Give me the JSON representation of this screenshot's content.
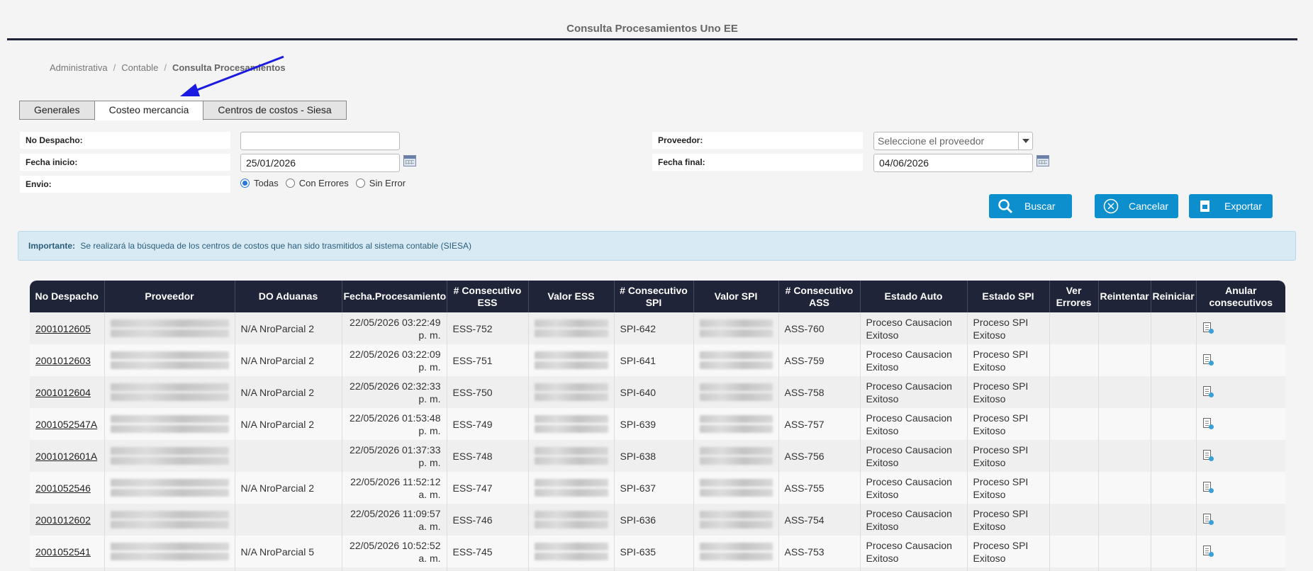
{
  "page": {
    "title": "Consulta Procesamientos Uno EE"
  },
  "breadcrumb": [
    "Administrativa",
    "Contable",
    "Consulta Procesamientos"
  ],
  "tabs": [
    "Generales",
    "Costeo mercancia",
    "Centros de costos - Siesa"
  ],
  "active_tab": "Costeo mercancia",
  "form": {
    "no_despacho_label": "No Despacho:",
    "no_despacho_value": "",
    "fecha_inicio_label": "Fecha inicio:",
    "fecha_inicio_value": "25/01/2026",
    "envio_label": "Envio:",
    "envio_options": [
      "Todas",
      "Con Errores",
      "Sin Error"
    ],
    "envio_selected": "Todas",
    "proveedor_label": "Proveedor:",
    "proveedor_placeholder": "Seleccione el proveedor",
    "fecha_final_label": "Fecha final:",
    "fecha_final_value": "04/06/2026"
  },
  "buttons": {
    "buscar": "Buscar",
    "cancelar": "Cancelar",
    "exportar": "Exportar"
  },
  "notice": {
    "strong": "Importante:",
    "text": "Se realizará la búsqueda de los centros de costos que han sido trasmitidos al sistema contable (SIESA)"
  },
  "table": {
    "headers": [
      "No Despacho",
      "Proveedor",
      "DO Aduanas",
      "Fecha.Procesamiento",
      "# Consecutivo ESS",
      "Valor ESS",
      "# Consecutivo SPI",
      "Valor SPI",
      "# Consecutivo ASS",
      "Estado Auto",
      "Estado SPI",
      "Ver Errores",
      "Reintentar",
      "Reiniciar",
      "Anular consecutivos"
    ],
    "rows": [
      {
        "no_despacho": "2001012605",
        "do_aduanas": "N/A NroParcial 2",
        "fecha": "22/05/2026 03:22:49 p. m.",
        "ess": "ESS-752",
        "spi": "SPI-642",
        "ass": "ASS-760",
        "estado_auto": "Proceso Causacion Exitoso",
        "estado_spi": "Proceso SPI Exitoso"
      },
      {
        "no_despacho": "2001012603",
        "do_aduanas": "N/A NroParcial 2",
        "fecha": "22/05/2026 03:22:09 p. m.",
        "ess": "ESS-751",
        "spi": "SPI-641",
        "ass": "ASS-759",
        "estado_auto": "Proceso Causacion Exitoso",
        "estado_spi": "Proceso SPI Exitoso"
      },
      {
        "no_despacho": "2001012604",
        "do_aduanas": "N/A NroParcial 2",
        "fecha": "22/05/2026 02:32:33 p. m.",
        "ess": "ESS-750",
        "spi": "SPI-640",
        "ass": "ASS-758",
        "estado_auto": "Proceso Causacion Exitoso",
        "estado_spi": "Proceso SPI Exitoso"
      },
      {
        "no_despacho": "2001052547A",
        "do_aduanas": "N/A NroParcial 2",
        "fecha": "22/05/2026 01:53:48 p. m.",
        "ess": "ESS-749",
        "spi": "SPI-639",
        "ass": "ASS-757",
        "estado_auto": "Proceso Causacion Exitoso",
        "estado_spi": "Proceso SPI Exitoso"
      },
      {
        "no_despacho": "2001012601A",
        "do_aduanas": "",
        "fecha": "22/05/2026 01:37:33 p. m.",
        "ess": "ESS-748",
        "spi": "SPI-638",
        "ass": "ASS-756",
        "estado_auto": "Proceso Causacion Exitoso",
        "estado_spi": "Proceso SPI Exitoso"
      },
      {
        "no_despacho": "2001052546",
        "do_aduanas": "N/A NroParcial 2",
        "fecha": "22/05/2026 11:52:12 a. m.",
        "ess": "ESS-747",
        "spi": "SPI-637",
        "ass": "ASS-755",
        "estado_auto": "Proceso Causacion Exitoso",
        "estado_spi": "Proceso SPI Exitoso"
      },
      {
        "no_despacho": "2001012602",
        "do_aduanas": "",
        "fecha": "22/05/2026 11:09:57 a. m.",
        "ess": "ESS-746",
        "spi": "SPI-636",
        "ass": "ASS-754",
        "estado_auto": "Proceso Causacion Exitoso",
        "estado_spi": "Proceso SPI Exitoso"
      },
      {
        "no_despacho": "2001052541",
        "do_aduanas": "N/A NroParcial 5",
        "fecha": "22/05/2026 10:52:52 a. m.",
        "ess": "ESS-745",
        "spi": "SPI-635",
        "ass": "ASS-753",
        "estado_auto": "Proceso Causacion Exitoso",
        "estado_spi": "Proceso SPI Exitoso"
      },
      {
        "no_despacho": "",
        "do_aduanas": "",
        "fecha": "",
        "ess": "",
        "spi": "",
        "ass": "",
        "estado_auto": "",
        "estado_spi": ""
      }
    ]
  },
  "icons": {
    "annotation_arrow": "arrow-icon",
    "calendar": "calendar-icon",
    "search": "search-icon",
    "cancel": "cancel-circle-icon",
    "export": "export-icon",
    "anular": "document-cancel-icon"
  },
  "colors": {
    "header_bg": "#1f2438",
    "button_bg": "#0d8fce",
    "notice_bg": "#d8ebf5",
    "arrow": "#1a1ae0"
  }
}
